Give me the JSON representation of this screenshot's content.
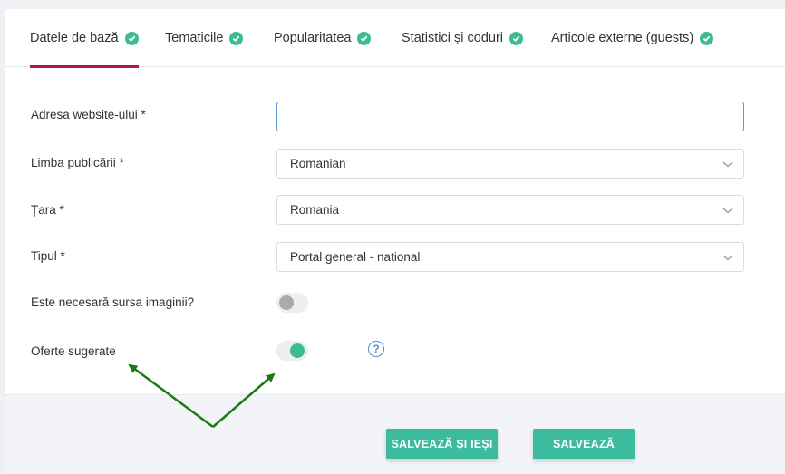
{
  "tabs": [
    {
      "label": "Datele de bază",
      "active": true
    },
    {
      "label": "Tematicile",
      "active": false
    },
    {
      "label": "Popularitatea",
      "active": false
    },
    {
      "label": "Statistici și coduri",
      "active": false
    },
    {
      "label": "Articole externe (guests)",
      "active": false
    }
  ],
  "form": {
    "website": {
      "label": "Adresa website-ului *",
      "value": ""
    },
    "language": {
      "label": "Limba publicării *",
      "value": "Romanian"
    },
    "country": {
      "label": "Țara *",
      "value": "Romania"
    },
    "type": {
      "label": "Tipul *",
      "value": "Portal general - național"
    },
    "image_source": {
      "label": "Este necesară sursa imaginii?",
      "enabled": false
    },
    "suggested_offers": {
      "label": "Oferte sugerate",
      "enabled": true
    }
  },
  "help_icon": "?",
  "buttons": {
    "save_exit": "SALVEAZĂ ȘI IEȘI",
    "save": "SALVEAZĂ"
  },
  "colors": {
    "accent": "#3dbb91",
    "active_tab_underline": "#b5183f",
    "annotation_arrow": "#1a7a12",
    "focus_border": "#5b9bd8"
  }
}
